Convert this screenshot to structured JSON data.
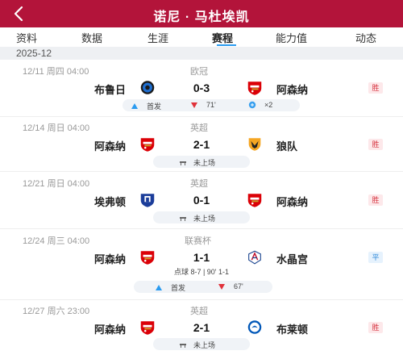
{
  "header": {
    "back_icon": "chevron-left-icon",
    "title": "诺尼 · 马杜埃凯",
    "bg_color": "#b3143a"
  },
  "tabs": [
    {
      "label": "资料"
    },
    {
      "label": "数据"
    },
    {
      "label": "生涯"
    },
    {
      "label": "赛程",
      "active": true
    },
    {
      "label": "能力值"
    },
    {
      "label": "动态"
    }
  ],
  "month_label": "2025-12",
  "matches": [
    {
      "datetime": "12/11 周四 04:00",
      "competition": "欧冠",
      "home": "布鲁日",
      "home_logo": "club-brugge-logo",
      "score": "0-3",
      "away": "阿森纳",
      "away_logo": "arsenal-logo",
      "result": "胜",
      "stats": {
        "start": "首发",
        "sub_off": "71'",
        "assists": "×2"
      }
    },
    {
      "datetime": "12/14 周日 04:00",
      "competition": "英超",
      "home": "阿森纳",
      "home_logo": "arsenal-logo",
      "score": "2-1",
      "away": "狼队",
      "away_logo": "wolves-logo",
      "result": "胜",
      "bench": "未上场"
    },
    {
      "datetime": "12/21 周日 04:00",
      "competition": "英超",
      "home": "埃弗顿",
      "home_logo": "everton-logo",
      "score": "0-1",
      "away": "阿森纳",
      "away_logo": "arsenal-logo",
      "result": "胜",
      "bench": "未上场"
    },
    {
      "datetime": "12/24 周三 04:00",
      "competition": "联赛杯",
      "home": "阿森纳",
      "home_logo": "arsenal-logo",
      "score": "1-1",
      "away": "水晶宫",
      "away_logo": "crystal-palace-logo",
      "result": "平",
      "penalty": "点球 8-7 | 90' 1-1",
      "stats": {
        "start": "首发",
        "sub_off": "67'"
      }
    },
    {
      "datetime": "12/27 周六 23:00",
      "competition": "英超",
      "home": "阿森纳",
      "home_logo": "arsenal-logo",
      "score": "2-1",
      "away": "布莱顿",
      "away_logo": "brighton-logo",
      "result": "胜",
      "bench": "未上场"
    }
  ],
  "colors": {
    "win": "#d6333f",
    "draw": "#2a87d8",
    "accent": "#2a9bf0",
    "arsenal": "#db0007"
  }
}
